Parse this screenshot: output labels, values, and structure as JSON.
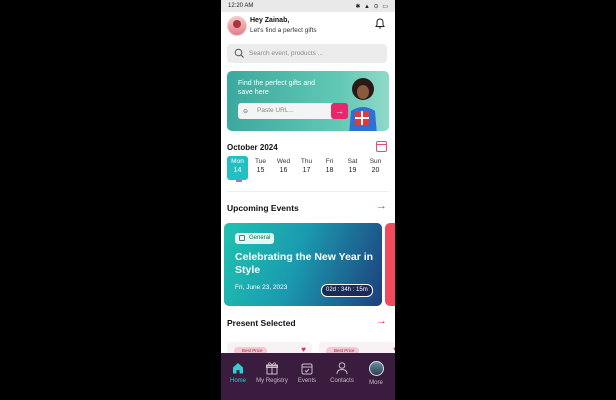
{
  "status_bar": {
    "time": "12:20 AM",
    "icons": "✱ ▲ ⊙ ▭"
  },
  "header": {
    "greeting": "Hey Zainab,",
    "subtitle": "Let's find a perfect gifts"
  },
  "search": {
    "placeholder": "Search event, products ..."
  },
  "promo": {
    "text": "Find the perfect gifts and save here",
    "input_placeholder": "Paste URL...",
    "button_icon": "arrow-right-icon"
  },
  "calendar": {
    "month": "October 2024",
    "days": [
      {
        "name": "Mon",
        "date": "14",
        "selected": true
      },
      {
        "name": "Tue",
        "date": "15"
      },
      {
        "name": "Wed",
        "date": "16"
      },
      {
        "name": "Thu",
        "date": "17"
      },
      {
        "name": "Fri",
        "date": "18"
      },
      {
        "name": "Sat",
        "date": "19"
      },
      {
        "name": "Sun",
        "date": "20"
      }
    ]
  },
  "upcoming": {
    "title": "Upcoming Events",
    "event": {
      "category": "General",
      "title": "Celebrating the New Year in Style",
      "date": "Fri, June 23, 2023",
      "countdown": "02d : 34h : 15m"
    }
  },
  "presents": {
    "title": "Present Selected",
    "items": [
      {
        "tag": "Best Price"
      },
      {
        "tag": "Best Price"
      }
    ]
  },
  "nav": [
    {
      "label": "Home",
      "icon": "home-icon",
      "active": true
    },
    {
      "label": "My Registry",
      "icon": "gift-icon"
    },
    {
      "label": "Events",
      "icon": "calendar-icon"
    },
    {
      "label": "Contacts",
      "icon": "person-icon"
    },
    {
      "label": "More",
      "icon": "avatar-icon"
    }
  ],
  "colors": {
    "accent": "#23bfc3",
    "brand_pink": "#e8266c",
    "nav_bg": "#3a1c3e"
  }
}
